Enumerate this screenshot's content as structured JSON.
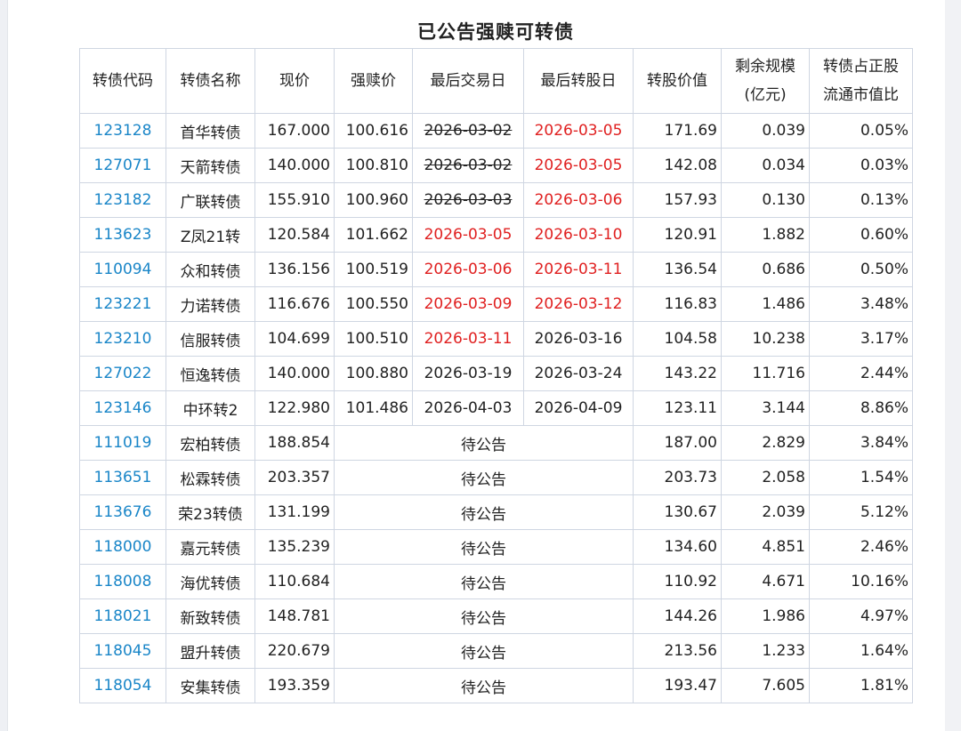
{
  "title": "已公告强赎可转债",
  "columns": [
    {
      "key": "code",
      "label": "转债代码"
    },
    {
      "key": "name",
      "label": "转债名称"
    },
    {
      "key": "price",
      "label": "现价"
    },
    {
      "key": "redeem_price",
      "label": "强赎价"
    },
    {
      "key": "last_trade",
      "label": "最后交易日"
    },
    {
      "key": "last_convert",
      "label": "最后转股日"
    },
    {
      "key": "convert_value",
      "label": "转股价值"
    },
    {
      "key": "remaining",
      "label": "剩余规模",
      "label2": "(亿元)"
    },
    {
      "key": "ratio",
      "label": "转债占正股",
      "label2": "流通市值比"
    }
  ],
  "pending_text": "待公告",
  "colors": {
    "link": "#1a86c8",
    "highlight_red": "#e02020",
    "border": "#cfd6e2"
  },
  "rows": [
    {
      "code": "123128",
      "name": "首华转债",
      "price": "167.000",
      "redeem_price": "100.616",
      "last_trade": "2026-03-02",
      "last_trade_style": "strike",
      "last_convert": "2026-03-05",
      "last_convert_style": "red",
      "convert_value": "171.69",
      "remaining": "0.039",
      "ratio": "0.05%"
    },
    {
      "code": "127071",
      "name": "天箭转债",
      "price": "140.000",
      "redeem_price": "100.810",
      "last_trade": "2026-03-02",
      "last_trade_style": "strike",
      "last_convert": "2026-03-05",
      "last_convert_style": "red",
      "convert_value": "142.08",
      "remaining": "0.034",
      "ratio": "0.03%"
    },
    {
      "code": "123182",
      "name": "广联转债",
      "price": "155.910",
      "redeem_price": "100.960",
      "last_trade": "2026-03-03",
      "last_trade_style": "strike",
      "last_convert": "2026-03-06",
      "last_convert_style": "red",
      "convert_value": "157.93",
      "remaining": "0.130",
      "ratio": "0.13%"
    },
    {
      "code": "113623",
      "name": "Z凤21转",
      "price": "120.584",
      "redeem_price": "101.662",
      "last_trade": "2026-03-05",
      "last_trade_style": "red",
      "last_convert": "2026-03-10",
      "last_convert_style": "red",
      "convert_value": "120.91",
      "remaining": "1.882",
      "ratio": "0.60%"
    },
    {
      "code": "110094",
      "name": "众和转债",
      "price": "136.156",
      "redeem_price": "100.519",
      "last_trade": "2026-03-06",
      "last_trade_style": "red",
      "last_convert": "2026-03-11",
      "last_convert_style": "red",
      "convert_value": "136.54",
      "remaining": "0.686",
      "ratio": "0.50%"
    },
    {
      "code": "123221",
      "name": "力诺转债",
      "price": "116.676",
      "redeem_price": "100.550",
      "last_trade": "2026-03-09",
      "last_trade_style": "red",
      "last_convert": "2026-03-12",
      "last_convert_style": "red",
      "convert_value": "116.83",
      "remaining": "1.486",
      "ratio": "3.48%"
    },
    {
      "code": "123210",
      "name": "信服转债",
      "price": "104.699",
      "redeem_price": "100.510",
      "last_trade": "2026-03-11",
      "last_trade_style": "red",
      "last_convert": "2026-03-16",
      "last_convert_style": "normal",
      "convert_value": "104.58",
      "remaining": "10.238",
      "ratio": "3.17%"
    },
    {
      "code": "127022",
      "name": "恒逸转债",
      "price": "140.000",
      "redeem_price": "100.880",
      "last_trade": "2026-03-19",
      "last_trade_style": "normal",
      "last_convert": "2026-03-24",
      "last_convert_style": "normal",
      "convert_value": "143.22",
      "remaining": "11.716",
      "ratio": "2.44%"
    },
    {
      "code": "123146",
      "name": "中环转2",
      "price": "122.980",
      "redeem_price": "101.486",
      "last_trade": "2026-04-03",
      "last_trade_style": "normal",
      "last_convert": "2026-04-09",
      "last_convert_style": "normal",
      "convert_value": "123.11",
      "remaining": "3.144",
      "ratio": "8.86%"
    },
    {
      "code": "111019",
      "name": "宏柏转债",
      "price": "188.854",
      "pending": true,
      "convert_value": "187.00",
      "remaining": "2.829",
      "ratio": "3.84%"
    },
    {
      "code": "113651",
      "name": "松霖转债",
      "price": "203.357",
      "pending": true,
      "convert_value": "203.73",
      "remaining": "2.058",
      "ratio": "1.54%"
    },
    {
      "code": "113676",
      "name": "荣23转债",
      "price": "131.199",
      "pending": true,
      "convert_value": "130.67",
      "remaining": "2.039",
      "ratio": "5.12%"
    },
    {
      "code": "118000",
      "name": "嘉元转债",
      "price": "135.239",
      "pending": true,
      "convert_value": "134.60",
      "remaining": "4.851",
      "ratio": "2.46%"
    },
    {
      "code": "118008",
      "name": "海优转债",
      "price": "110.684",
      "pending": true,
      "convert_value": "110.92",
      "remaining": "4.671",
      "ratio": "10.16%"
    },
    {
      "code": "118021",
      "name": "新致转债",
      "price": "148.781",
      "pending": true,
      "convert_value": "144.26",
      "remaining": "1.986",
      "ratio": "4.97%"
    },
    {
      "code": "118045",
      "name": "盟升转债",
      "price": "220.679",
      "pending": true,
      "convert_value": "213.56",
      "remaining": "1.233",
      "ratio": "1.64%"
    },
    {
      "code": "118054",
      "name": "安集转债",
      "price": "193.359",
      "pending": true,
      "convert_value": "193.47",
      "remaining": "7.605",
      "ratio": "1.81%"
    }
  ]
}
